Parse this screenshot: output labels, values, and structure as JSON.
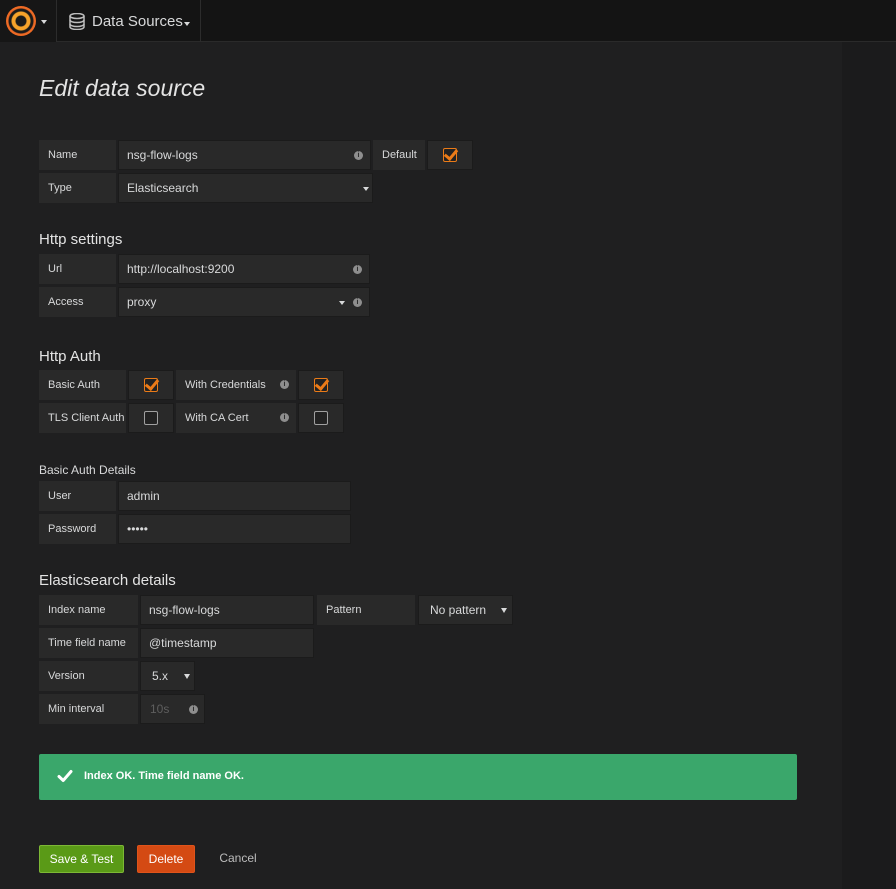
{
  "nav": {
    "section_label": "Data Sources"
  },
  "page": {
    "title": "Edit data source"
  },
  "general": {
    "name_label": "Name",
    "name_value": "nsg-flow-logs",
    "default_label": "Default",
    "default_checked": true,
    "type_label": "Type",
    "type_value": "Elasticsearch"
  },
  "http_settings": {
    "title": "Http settings",
    "url_label": "Url",
    "url_value": "http://localhost:9200",
    "access_label": "Access",
    "access_value": "proxy"
  },
  "http_auth": {
    "title": "Http Auth",
    "basic_auth_label": "Basic Auth",
    "basic_auth_checked": true,
    "with_credentials_label": "With Credentials",
    "with_credentials_checked": true,
    "tls_client_auth_label": "TLS Client Auth",
    "tls_client_auth_checked": false,
    "with_ca_cert_label": "With CA Cert",
    "with_ca_cert_checked": false
  },
  "basic_auth_details": {
    "title": "Basic Auth Details",
    "user_label": "User",
    "user_value": "admin",
    "password_label": "Password",
    "password_value": "•••••"
  },
  "elasticsearch": {
    "title": "Elasticsearch details",
    "index_name_label": "Index name",
    "index_name_value": "nsg-flow-logs",
    "pattern_label": "Pattern",
    "pattern_value": "No pattern",
    "time_field_label": "Time field name",
    "time_field_value": "@timestamp",
    "version_label": "Version",
    "version_value": "5.x",
    "min_interval_label": "Min interval",
    "min_interval_placeholder": "10s"
  },
  "alert": {
    "message": "Index OK. Time field name OK."
  },
  "buttons": {
    "save": "Save & Test",
    "delete": "Delete",
    "cancel": "Cancel"
  },
  "colors": {
    "accent": "#eb7b18",
    "success": "#3aa76b",
    "save": "#5a9a17",
    "delete": "#d44a13"
  }
}
